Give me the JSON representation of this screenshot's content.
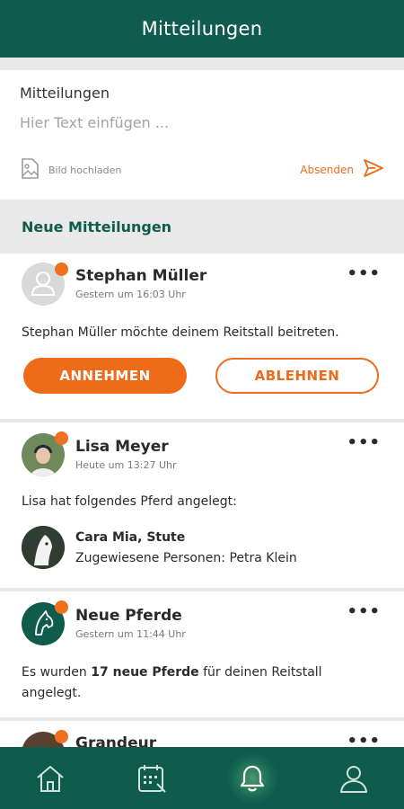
{
  "header": {
    "title": "Mitteilungen"
  },
  "compose": {
    "label": "Mitteilungen",
    "placeholder": "Hier Text einfügen ...",
    "upload_label": "Bild hochladen",
    "send_label": "Absenden"
  },
  "section_title": "Neue Mitteilungen",
  "notifications": [
    {
      "name": "Stephan Müller",
      "time": "Gestern um 16:03 Uhr",
      "text": "Stephan Müller möchte deinem Reitstall beitreten.",
      "accept_label": "ANNEHMEN",
      "reject_label": "ABLEHNEN"
    },
    {
      "name": "Lisa Meyer",
      "time": "Heute um 13:27 Uhr",
      "text": "Lisa hat folgendes Pferd angelegt:",
      "horse": {
        "name": "Cara Mia, Stute",
        "persons": "Zugewiesene Personen: Petra Klein"
      }
    },
    {
      "name": "Neue Pferde",
      "time": "Gestern um 11:44 Uhr",
      "text_pre": "Es wurden ",
      "text_bold": "17 neue Pferde",
      "text_post": " für deinen Reitstall angelegt."
    },
    {
      "name": "Grandeur"
    }
  ],
  "more_label": "•••",
  "tabbar": {
    "items": [
      "home-icon",
      "calendar-icon",
      "bell-icon",
      "profile-icon"
    ],
    "active": "bell-icon"
  },
  "colors": {
    "brand": "#0f5c4c",
    "accent": "#ee6b1a",
    "badge": "#f07020"
  }
}
